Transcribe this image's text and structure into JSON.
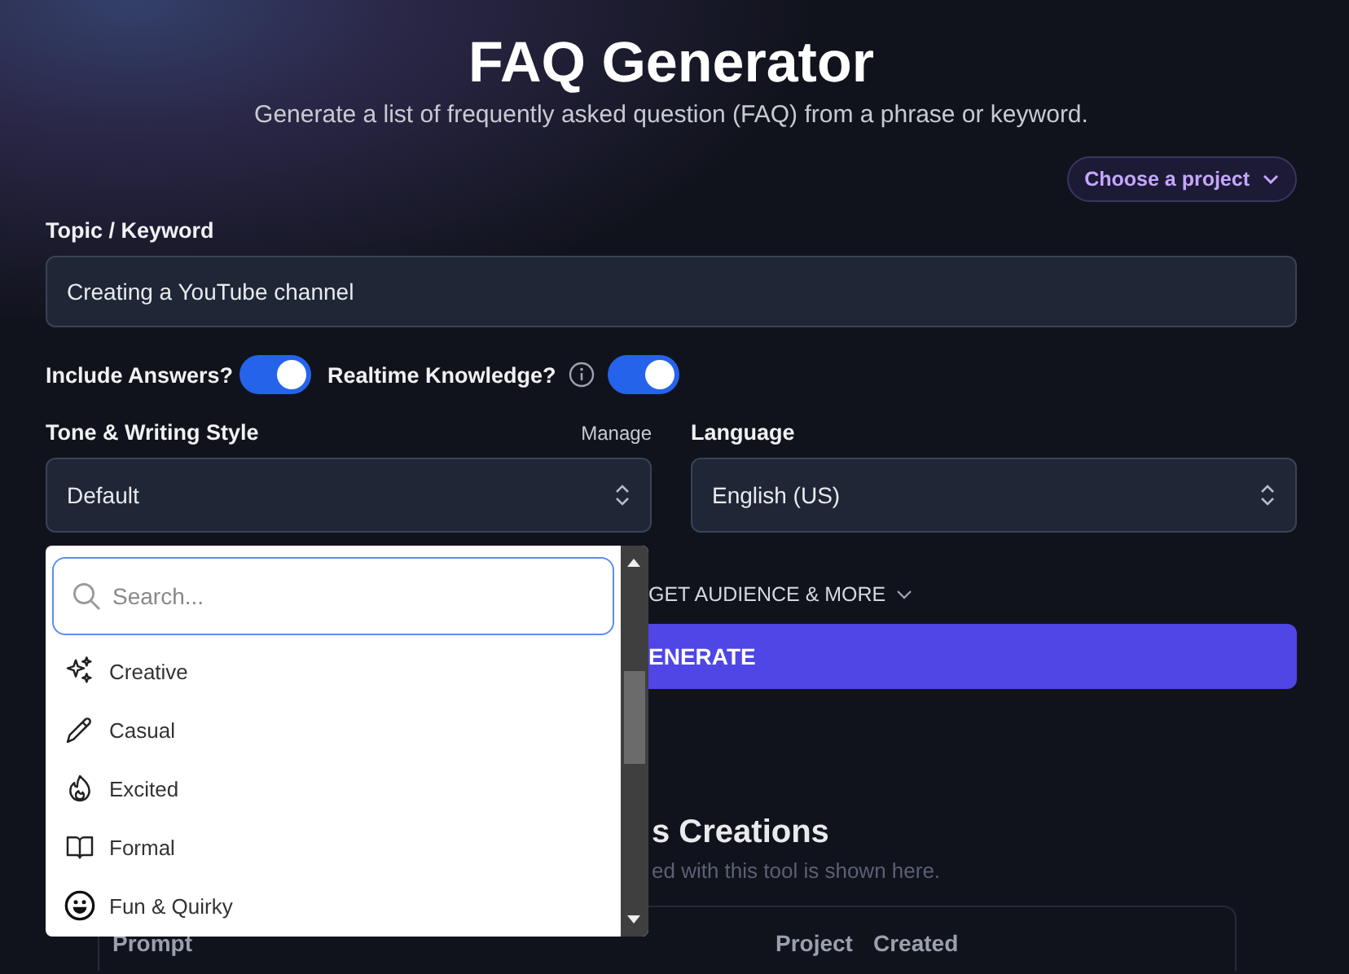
{
  "header": {
    "title": "FAQ Generator",
    "subtitle": "Generate a list of frequently asked question (FAQ) from a phrase or keyword."
  },
  "project_button": "Choose a project",
  "topic": {
    "label": "Topic / Keyword",
    "value": "Creating a YouTube channel"
  },
  "toggles": [
    {
      "label": "Include Answers?",
      "on": true,
      "info": false
    },
    {
      "label": "Realtime Knowledge?",
      "on": true,
      "info": true
    }
  ],
  "tone": {
    "label": "Tone & Writing Style",
    "manage": "Manage",
    "value": "Default"
  },
  "language": {
    "label": "Language",
    "value": "English (US)"
  },
  "more_link": "GET AUDIENCE & MORE",
  "generate_button": "ENERATE",
  "history": {
    "title": "s Creations",
    "subtitle": "ed with this tool is shown here.",
    "columns": [
      "Prompt",
      "Project",
      "Created"
    ]
  },
  "dropdown": {
    "placeholder": "Search...",
    "items": [
      {
        "label": "Creative",
        "kind": "sparkles"
      },
      {
        "label": "Casual",
        "kind": "pencil"
      },
      {
        "label": "Excited",
        "kind": "flame"
      },
      {
        "label": "Formal",
        "kind": "book"
      },
      {
        "label": "Fun & Quirky",
        "kind": "smile"
      }
    ]
  }
}
